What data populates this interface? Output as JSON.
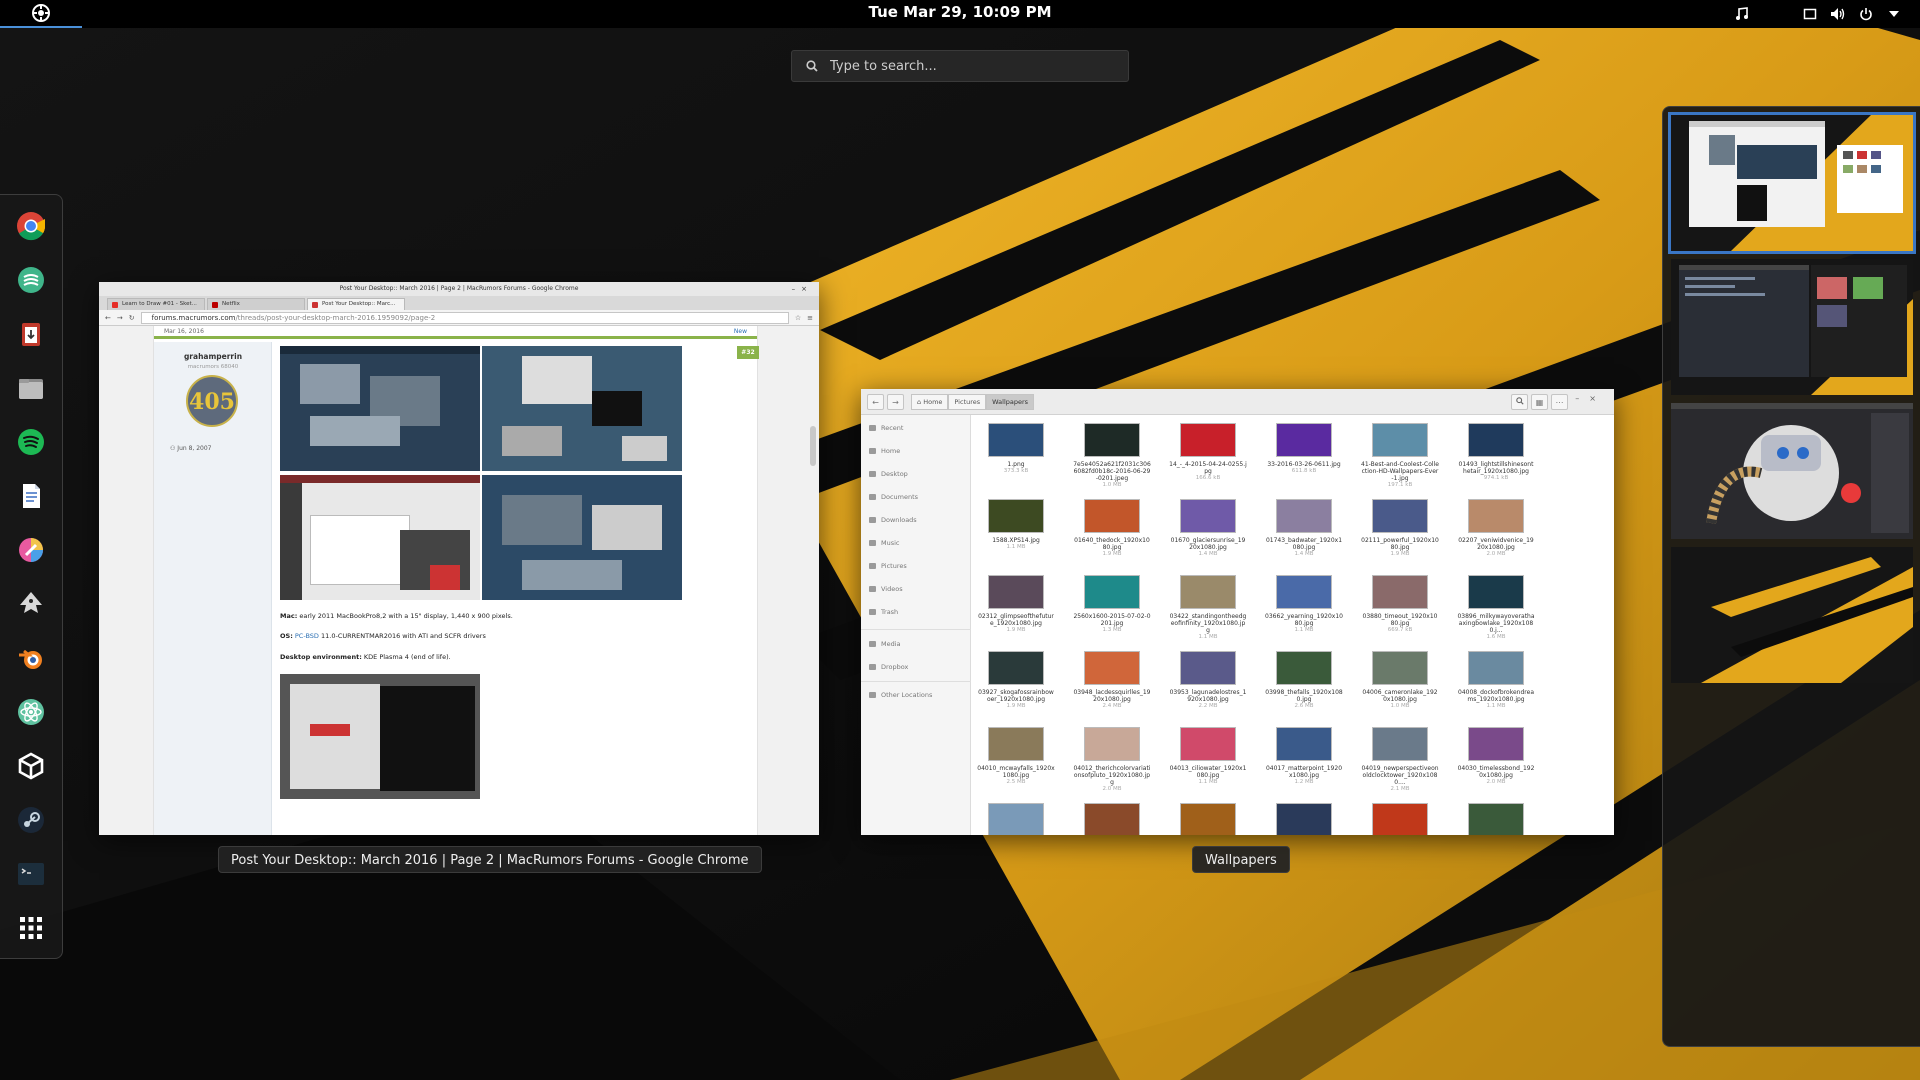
{
  "topbar": {
    "clock": "Tue Mar 29, 10:09 PM",
    "activities_icon": "system-logo-icon",
    "tray_icons": [
      "music-icon",
      "window-icon",
      "volume-icon",
      "power-icon",
      "chevron-down-icon"
    ]
  },
  "search": {
    "placeholder": "Type to search..."
  },
  "dock": {
    "items": [
      "chrome-icon",
      "marker-icon",
      "clipboard-icon",
      "files-icon",
      "spotify-icon",
      "document-icon",
      "color-picker-icon",
      "inkscape-icon",
      "blender-icon",
      "atom-icon",
      "unity-icon",
      "steam-icon",
      "terminal-icon",
      "app-grid-icon"
    ]
  },
  "chrome": {
    "caption": "Post Your Desktop:: March 2016 | Page 2 | MacRumors Forums - Google Chrome",
    "title": "Post Your Desktop:: March 2016 | Page 2 | MacRumors Forums - Google Chrome",
    "tabs": [
      "Learn to Draw #01 - Sket...",
      "Netflix",
      "Post Your Desktop:: Marc..."
    ],
    "url_host": "forums.macrumors.com",
    "url_path": "/threads/post-your-desktop-march-2016.1959092/page-2",
    "post": {
      "date": "Mar 16, 2016",
      "new_label": "New",
      "post_number": "#32",
      "username": "grahamperrin",
      "user_role": "macrumors 68040",
      "avatar_text": "405",
      "join_date": "Jun 8, 2007",
      "mac_label": "Mac:",
      "mac_text": "early 2011 MacBookPro8,2 with a 15\" display, 1,440 x 900 pixels.",
      "os_label": "OS:",
      "os_link": "PC-BSD",
      "os_text": "11.0-CURRENTMAR2016 with ATI and SCFR drivers",
      "de_label": "Desktop environment:",
      "de_text": "KDE Plasma 4 (end of life)."
    }
  },
  "files": {
    "caption": "Wallpapers",
    "breadcrumbs": [
      "Home",
      "Pictures",
      "Wallpapers"
    ],
    "sidebar": [
      "Recent",
      "Home",
      "Desktop",
      "Documents",
      "Downloads",
      "Music",
      "Pictures",
      "Videos",
      "Trash",
      "Media",
      "Dropbox",
      "Other Locations"
    ],
    "files": [
      {
        "name": "1.png",
        "size": "373.3 kB",
        "color": "#2b4f7a"
      },
      {
        "name": "7e5e4052a621f2031c3066082fd0b18c-2016-06-29-0201.jpeg",
        "size": "1.0 MB",
        "color": "#1e2a26"
      },
      {
        "name": "14_-_4-2015-04-24-0255.jpg",
        "size": "166.6 kB",
        "color": "#c8202a"
      },
      {
        "name": "33-2016-03-26-0611.jpg",
        "size": "611.8 kB",
        "color": "#5a2aa0"
      },
      {
        "name": "41-Best-and-Coolest-Collection-HD-Wallpapers-Ever-1.jpg",
        "size": "197.1 kB",
        "color": "#5d8ea8"
      },
      {
        "name": "01493_lightstillshinesonthetair_1920x1080.jpg",
        "size": "974.1 kB",
        "color": "#1f3a5c"
      },
      {
        "name": "1588.XPS14.jpg",
        "size": "1.1 MB",
        "color": "#3d4a22"
      },
      {
        "name": "01640_thedock_1920x1080.jpg",
        "size": "1.9 MB",
        "color": "#c2562a"
      },
      {
        "name": "01670_glaciersunrise_1920x1080.jpg",
        "size": "1.4 MB",
        "color": "#6f5aa8"
      },
      {
        "name": "01743_badwater_1920x1080.jpg",
        "size": "1.4 MB",
        "color": "#8b7fa0"
      },
      {
        "name": "02111_powerful_1920x1080.jpg",
        "size": "1.9 MB",
        "color": "#4a5a8a"
      },
      {
        "name": "02207_veniwidvenice_1920x1080.jpg",
        "size": "2.0 MB",
        "color": "#b98a6a"
      },
      {
        "name": "02312_glimpseofthefuture_1920x1080.jpg",
        "size": "1.9 MB",
        "color": "#5a4a5a"
      },
      {
        "name": "2560x1600-2015-07-02-0201.jpg",
        "size": "1.3 MB",
        "color": "#1e8a8a"
      },
      {
        "name": "03422_standingontheedgeofinfinity_1920x1080.jpg",
        "size": "1.1 MB",
        "color": "#9a8a6a"
      },
      {
        "name": "03662_yearning_1920x1080.jpg",
        "size": "1.1 MB",
        "color": "#4a6aa8"
      },
      {
        "name": "03880_timeout_1920x1080.jpg",
        "size": "669.7 kB",
        "color": "#8a6a6a"
      },
      {
        "name": "03896_milkywayoverathaaxingbowlake_1920x1080.j...",
        "size": "1.6 MB",
        "color": "#1a3a4a"
      },
      {
        "name": "03927_skogafossrainbowoer_1920x1080.jpg",
        "size": "1.9 MB",
        "color": "#2a3a3a"
      },
      {
        "name": "03948_lacdessquirlles_1920x1080.jpg",
        "size": "2.4 MB",
        "color": "#d0663a"
      },
      {
        "name": "03953_lagunadelostres_1920x1080.jpg",
        "size": "2.2 MB",
        "color": "#5a5a8a"
      },
      {
        "name": "03998_thefalls_1920x1080.jpg",
        "size": "2.6 MB",
        "color": "#3a5a3a"
      },
      {
        "name": "04006_cameronlake_1920x1080.jpg",
        "size": "1.0 MB",
        "color": "#6a7a6a"
      },
      {
        "name": "04008_dockofbrokendreams_1920x1080.jpg",
        "size": "1.1 MB",
        "color": "#6a8aa0"
      },
      {
        "name": "04010_mcwayfalls_1920x1080.jpg",
        "size": "2.5 MB",
        "color": "#8a7a5a"
      },
      {
        "name": "04012_therichcolorvariationsofpluto_1920x1080.jpg",
        "size": "2.0 MB",
        "color": "#c8a898"
      },
      {
        "name": "04013_ciliowater_1920x1080.jpg",
        "size": "1.1 MB",
        "color": "#d04a6a"
      },
      {
        "name": "04017_matterpoint_1920x1080.jpg",
        "size": "1.2 MB",
        "color": "#3a5a8a"
      },
      {
        "name": "04019_newperspectiveonoldclocktower_1920x1080....",
        "size": "2.1 MB",
        "color": "#6a7a8a"
      },
      {
        "name": "04030_timelessbond_1920x1080.jpg",
        "size": "2.0 MB",
        "color": "#7a4a8a"
      }
    ],
    "partial_row_colors": [
      "#7a9ab8",
      "#8a4a2a",
      "#a0601a",
      "#2a3a5a",
      "#c0381a",
      "#3a5a3a"
    ]
  },
  "workspaces": {
    "count": 4,
    "active": 1
  },
  "colors": {
    "accent": "#3a76c4",
    "wallpaper_yellow": "#e3a71c",
    "panel": "#181818"
  }
}
